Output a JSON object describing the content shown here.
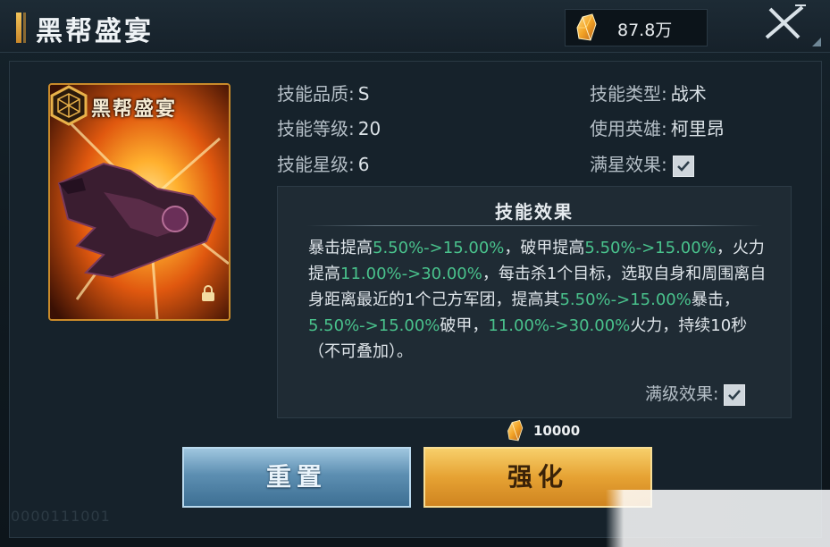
{
  "header": {
    "title": "黑帮盛宴",
    "currency_value": "87.8万",
    "currency_icon": "crystal-icon",
    "close_icon": "close-icon"
  },
  "card": {
    "name": "黑帮盛宴",
    "emblem_icon": "hex-emblem-icon",
    "lock_icon": "lock-icon"
  },
  "info": {
    "quality_label": "技能品质:",
    "quality_value": "S",
    "level_label": "技能等级:",
    "level_value": "20",
    "star_label": "技能星级:",
    "star_value": "6",
    "type_label": "技能类型:",
    "type_value": "战术",
    "hero_label": "使用英雄:",
    "hero_value": "柯里昂",
    "fullstar_label": "满星效果:",
    "fullstar_checked": true
  },
  "effect": {
    "title": "技能效果",
    "t1": "暴击提高",
    "v1": "5.50%->15.00%",
    "t2": "，破甲提高",
    "v2": "5.50%->15.00%",
    "t3": "，",
    "t4": "火力提高",
    "v3": "11.00%->30.00%",
    "t5": "，每击杀1个目标，选取自身和周围离自身距离最近的1个己方军团，提高其",
    "v4": "5.50%->15.00%",
    "t6": "暴击，",
    "v5": "5.50%->15.00%",
    "t7": "破甲，",
    "v6": "11.00%->30.00%",
    "t8": "火力，持续10秒（不可叠加）。",
    "maxlevel_label": "满级效果:",
    "maxlevel_checked": true
  },
  "cost": {
    "value": "10000",
    "icon": "crystal-icon"
  },
  "buttons": {
    "reset_label": "重置",
    "upgrade_label": "强化"
  },
  "footer": {
    "id_text": "0000111001"
  },
  "colors": {
    "highlight": "#49c28c",
    "gold": "#e6a233",
    "blue_button": "#5d8fb2"
  }
}
